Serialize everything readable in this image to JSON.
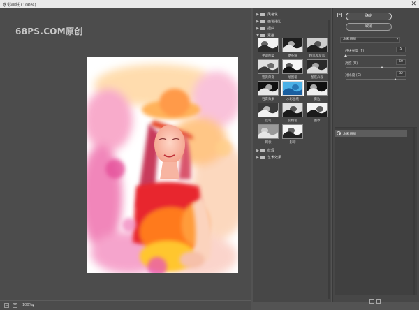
{
  "window": {
    "title": "水彩画纸 (100%)",
    "close_glyph": "✕"
  },
  "watermark": "68PS.COM原创",
  "zoom": {
    "value": "100%",
    "minus": "−",
    "plus": "+",
    "dropdown_glyph": "▾"
  },
  "gallery": {
    "folders_top": [
      {
        "label": "风格化",
        "expanded": false
      },
      {
        "label": "画笔描边",
        "expanded": false
      },
      {
        "label": "扭曲",
        "expanded": false
      },
      {
        "label": "素描",
        "expanded": true
      }
    ],
    "thumbnails": [
      {
        "label": "半调图案",
        "selected": false
      },
      {
        "label": "便条纸",
        "selected": false
      },
      {
        "label": "粉笔和炭笔",
        "selected": false
      },
      {
        "label": "铬黄渐变",
        "selected": false
      },
      {
        "label": "绘图笔",
        "selected": false
      },
      {
        "label": "基底凸现",
        "selected": false
      },
      {
        "label": "石膏效果",
        "selected": false
      },
      {
        "label": "水彩画纸",
        "selected": true
      },
      {
        "label": "撕边",
        "selected": false
      },
      {
        "label": "炭笔",
        "selected": false
      },
      {
        "label": "炭精笔",
        "selected": false
      },
      {
        "label": "图章",
        "selected": false
      },
      {
        "label": "网状",
        "selected": false
      },
      {
        "label": "影印",
        "selected": false
      }
    ],
    "folders_bottom": [
      {
        "label": "纹理",
        "expanded": false
      },
      {
        "label": "艺术效果",
        "expanded": false
      }
    ]
  },
  "right_panel": {
    "collapse_glyph": "⊞",
    "ok_label": "确定",
    "cancel_label": "取消",
    "filter_select": "水彩画纸",
    "params": [
      {
        "label": "纤维长度 (F)",
        "value": "5",
        "fraction": 0.0
      },
      {
        "label": "亮度 (B)",
        "value": "60",
        "fraction": 0.6
      },
      {
        "label": "对比度 (C)",
        "value": "82",
        "fraction": 0.82
      }
    ],
    "layer_name": "水彩画纸"
  },
  "colors": {
    "background": "#535353",
    "panel": "#474747",
    "pink": "#f26aa8",
    "orange": "#ffab3a",
    "red": "#e01e2c",
    "yellow": "#ffd23c"
  },
  "icons": [
    "eye-icon",
    "new-layer-icon",
    "trash-icon",
    "folder-icon"
  ]
}
